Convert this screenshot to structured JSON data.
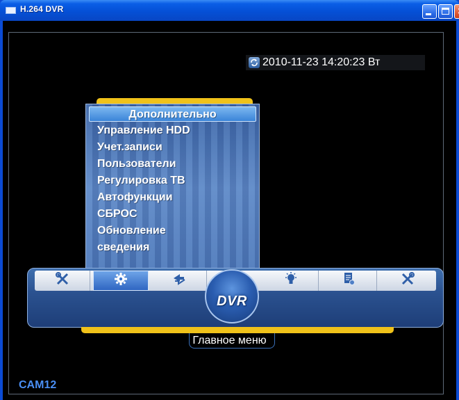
{
  "window": {
    "title": "H.264 DVR"
  },
  "osd": {
    "datetime": "2010-11-23 14:20:23 Вт",
    "camera": "CAM12"
  },
  "submenu": {
    "items": [
      {
        "label": "Дополнительно",
        "selected": true
      },
      {
        "label": "Управление HDD",
        "selected": false
      },
      {
        "label": "Учет.записи",
        "selected": false
      },
      {
        "label": "Пользователи",
        "selected": false
      },
      {
        "label": "Регулировка ТВ",
        "selected": false
      },
      {
        "label": "Автофункции",
        "selected": false
      },
      {
        "label": "СБРОС",
        "selected": false
      },
      {
        "label": "Обновление",
        "selected": false
      },
      {
        "label": "сведения",
        "selected": false
      }
    ]
  },
  "toolbar": {
    "logo": "DVR",
    "buttons": [
      {
        "icon": "tools-icon",
        "active": false
      },
      {
        "icon": "gear-icon",
        "active": true
      },
      {
        "icon": "arrows-icon",
        "active": false
      },
      {
        "icon": "lightbulb-icon",
        "active": false
      },
      {
        "icon": "document-icon",
        "active": false
      },
      {
        "icon": "tools-icon",
        "active": false
      }
    ],
    "caption": "Главное меню"
  },
  "colors": {
    "accent_yellow": "#f0c21a",
    "panel_blue": "#2b5290",
    "camera_label": "#4a8ff5"
  }
}
